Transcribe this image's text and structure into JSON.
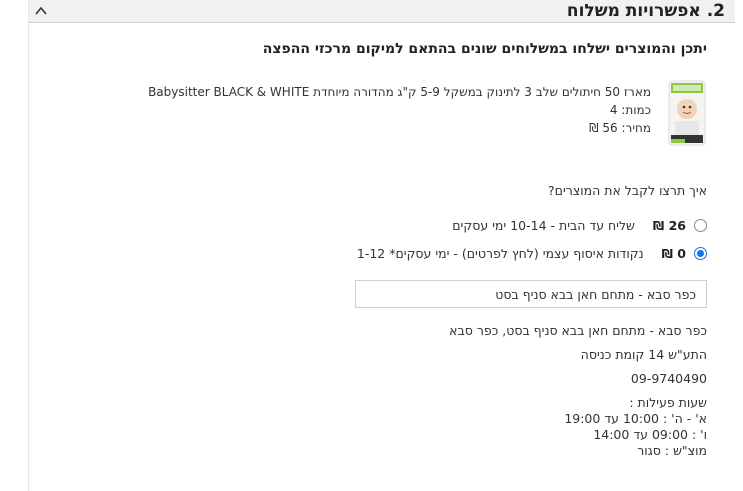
{
  "section": {
    "title": "2. אפשרויות משלוח"
  },
  "notice": "יתכן והמוצרים ישלחו במשלוחים שונים בהתאם למיקום מרכזי ההפצה",
  "product": {
    "image_icon": "diaper-pack-image",
    "name": "מארז 50 חיתולים שלב 3 לתינוק במשקל 5-9 ק\"ג מהדורה מיוחדת Babysitter BLACK & WHITE",
    "quantity": "כמות: 4",
    "price": "מחיר: 56 ₪"
  },
  "question": "איך תרצו לקבל את המוצרים?",
  "options": [
    {
      "price": "26",
      "currency": "₪",
      "label": "שליח עד הבית - 10-14 ימי עסקים",
      "selected": false
    },
    {
      "price": "0",
      "currency": "₪",
      "label": "נקודות איסוף עצמי (לחץ לפרטים) - ימי עסקים* 1-12",
      "selected": true
    }
  ],
  "pickup": {
    "selected_store": "כפר סבא - מתחם חאן בבא סניף בסט",
    "address": "כפר סבא - מתחם חאן בבא סניף בסט, כפר סבא",
    "directions": "התע\"ש 14 קומת כניסה",
    "phone": "09-9740490",
    "hours_title": "שעות פעילות :",
    "hours": [
      "א' - ה' : 10:00 עד 19:00",
      "ו' : 09:00 עד 14:00",
      "מוצ\"ש : סגור"
    ]
  },
  "colors": {
    "accent": "#1a73e8",
    "header_bg": "#f1f1f1",
    "text": "#333333"
  },
  "icons": {
    "collapse": "chevron-up-icon"
  }
}
